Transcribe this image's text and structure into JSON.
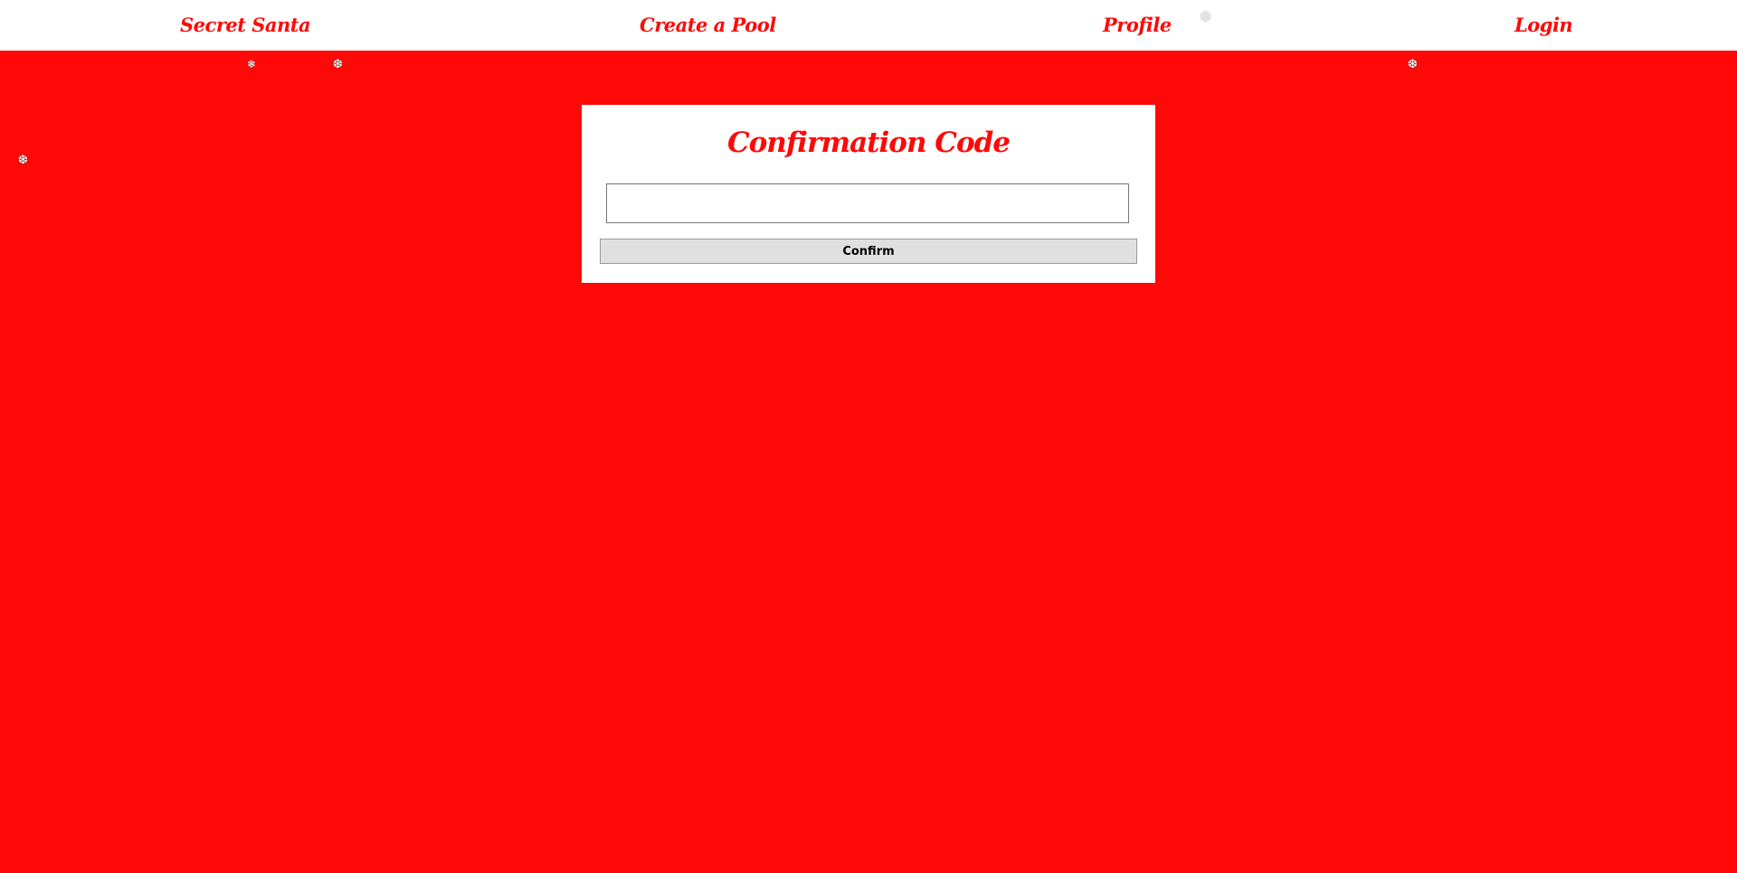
{
  "nav": {
    "home_label": "Secret Santa",
    "create_label": "Create a Pool",
    "profile_label": "Profile",
    "login_label": "Login"
  },
  "snowflakes": {
    "glyph_a": "❄",
    "glyph_b": "❆"
  },
  "confirmation": {
    "title": "Confirmation Code",
    "code_value": "",
    "code_placeholder": "",
    "confirm_label": "Confirm"
  },
  "colors": {
    "background": "#ff0808",
    "accent": "#ff0808",
    "card": "#ffffff"
  }
}
